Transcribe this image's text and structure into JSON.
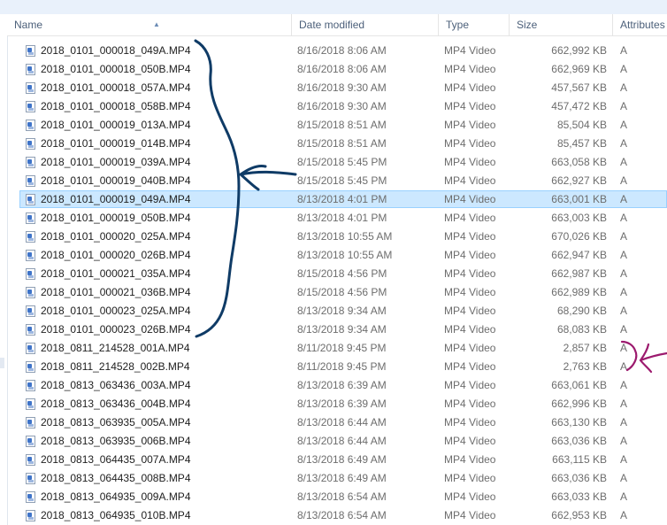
{
  "columns": {
    "name": "Name",
    "date_modified": "Date modified",
    "type": "Type",
    "size": "Size",
    "attributes": "Attributes"
  },
  "rows": [
    {
      "name": "2018_0101_000018_049A.MP4",
      "date": "8/16/2018 8:06 AM",
      "type": "MP4 Video",
      "size": "662,992 KB",
      "attr": "A"
    },
    {
      "name": "2018_0101_000018_050B.MP4",
      "date": "8/16/2018 8:06 AM",
      "type": "MP4 Video",
      "size": "662,969 KB",
      "attr": "A"
    },
    {
      "name": "2018_0101_000018_057A.MP4",
      "date": "8/16/2018 9:30 AM",
      "type": "MP4 Video",
      "size": "457,567 KB",
      "attr": "A"
    },
    {
      "name": "2018_0101_000018_058B.MP4",
      "date": "8/16/2018 9:30 AM",
      "type": "MP4 Video",
      "size": "457,472 KB",
      "attr": "A"
    },
    {
      "name": "2018_0101_000019_013A.MP4",
      "date": "8/15/2018 8:51 AM",
      "type": "MP4 Video",
      "size": "85,504 KB",
      "attr": "A"
    },
    {
      "name": "2018_0101_000019_014B.MP4",
      "date": "8/15/2018 8:51 AM",
      "type": "MP4 Video",
      "size": "85,457 KB",
      "attr": "A"
    },
    {
      "name": "2018_0101_000019_039A.MP4",
      "date": "8/15/2018 5:45 PM",
      "type": "MP4 Video",
      "size": "663,058 KB",
      "attr": "A"
    },
    {
      "name": "2018_0101_000019_040B.MP4",
      "date": "8/15/2018 5:45 PM",
      "type": "MP4 Video",
      "size": "662,927 KB",
      "attr": "A"
    },
    {
      "name": "2018_0101_000019_049A.MP4",
      "date": "8/13/2018 4:01 PM",
      "type": "MP4 Video",
      "size": "663,001 KB",
      "attr": "A",
      "selected": true
    },
    {
      "name": "2018_0101_000019_050B.MP4",
      "date": "8/13/2018 4:01 PM",
      "type": "MP4 Video",
      "size": "663,003 KB",
      "attr": "A"
    },
    {
      "name": "2018_0101_000020_025A.MP4",
      "date": "8/13/2018 10:55 AM",
      "type": "MP4 Video",
      "size": "670,026 KB",
      "attr": "A"
    },
    {
      "name": "2018_0101_000020_026B.MP4",
      "date": "8/13/2018 10:55 AM",
      "type": "MP4 Video",
      "size": "662,947 KB",
      "attr": "A"
    },
    {
      "name": "2018_0101_000021_035A.MP4",
      "date": "8/15/2018 4:56 PM",
      "type": "MP4 Video",
      "size": "662,987 KB",
      "attr": "A"
    },
    {
      "name": "2018_0101_000021_036B.MP4",
      "date": "8/15/2018 4:56 PM",
      "type": "MP4 Video",
      "size": "662,989 KB",
      "attr": "A"
    },
    {
      "name": "2018_0101_000023_025A.MP4",
      "date": "8/13/2018 9:34 AM",
      "type": "MP4 Video",
      "size": "68,290 KB",
      "attr": "A"
    },
    {
      "name": "2018_0101_000023_026B.MP4",
      "date": "8/13/2018 9:34 AM",
      "type": "MP4 Video",
      "size": "68,083 KB",
      "attr": "A"
    },
    {
      "name": "2018_0811_214528_001A.MP4",
      "date": "8/11/2018 9:45 PM",
      "type": "MP4 Video",
      "size": "2,857 KB",
      "attr": "A"
    },
    {
      "name": "2018_0811_214528_002B.MP4",
      "date": "8/11/2018 9:45 PM",
      "type": "MP4 Video",
      "size": "2,763 KB",
      "attr": "A"
    },
    {
      "name": "2018_0813_063436_003A.MP4",
      "date": "8/13/2018 6:39 AM",
      "type": "MP4 Video",
      "size": "663,061 KB",
      "attr": "A"
    },
    {
      "name": "2018_0813_063436_004B.MP4",
      "date": "8/13/2018 6:39 AM",
      "type": "MP4 Video",
      "size": "662,996 KB",
      "attr": "A"
    },
    {
      "name": "2018_0813_063935_005A.MP4",
      "date": "8/13/2018 6:44 AM",
      "type": "MP4 Video",
      "size": "663,130 KB",
      "attr": "A"
    },
    {
      "name": "2018_0813_063935_006B.MP4",
      "date": "8/13/2018 6:44 AM",
      "type": "MP4 Video",
      "size": "663,036 KB",
      "attr": "A"
    },
    {
      "name": "2018_0813_064435_007A.MP4",
      "date": "8/13/2018 6:49 AM",
      "type": "MP4 Video",
      "size": "663,115 KB",
      "attr": "A"
    },
    {
      "name": "2018_0813_064435_008B.MP4",
      "date": "8/13/2018 6:49 AM",
      "type": "MP4 Video",
      "size": "663,036 KB",
      "attr": "A"
    },
    {
      "name": "2018_0813_064935_009A.MP4",
      "date": "8/13/2018 6:54 AM",
      "type": "MP4 Video",
      "size": "663,033 KB",
      "attr": "A"
    },
    {
      "name": "2018_0813_064935_010B.MP4",
      "date": "8/13/2018 6:54 AM",
      "type": "MP4 Video",
      "size": "662,953 KB",
      "attr": "A"
    }
  ],
  "icons": {
    "file": "video-file-icon",
    "sort": "sort-ascending-icon"
  },
  "colors": {
    "selection_fill": "#cce8ff",
    "selection_border": "#99d1ff",
    "annotation_blue": "#0f3b66",
    "annotation_magenta": "#9c1a6e"
  }
}
